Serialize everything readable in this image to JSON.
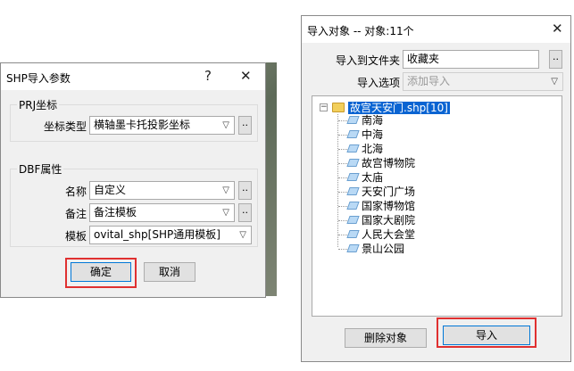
{
  "shp_dialog": {
    "title": "SHP导入参数",
    "help_glyph": "?",
    "close_glyph": "✕",
    "prj_group": {
      "label": "PRJ坐标",
      "coord_type_label": "坐标类型",
      "coord_type_value": "横轴墨卡托投影坐标"
    },
    "dbf_group": {
      "label": "DBF属性",
      "name_label": "名称",
      "name_value": "自定义",
      "note_label": "备注",
      "note_value": "备注模板",
      "template_label": "模板",
      "template_value": "ovital_shp[SHP通用模板]"
    },
    "browse_label": "..",
    "ok_label": "确定",
    "cancel_label": "取消"
  },
  "import_dialog": {
    "title": "导入对象 -- 对象:11个",
    "close_glyph": "✕",
    "folder_label": "导入到文件夹",
    "folder_value": "收藏夹",
    "option_label": "导入选项",
    "option_value": "添加导入",
    "browse_label": "..",
    "tree": {
      "root_label": "故宫天安门.shp[10]",
      "items": [
        "南海",
        "中海",
        "北海",
        "故宫博物院",
        "太庙",
        "天安门广场",
        "国家博物馆",
        "国家大剧院",
        "人民大会堂",
        "景山公园"
      ]
    },
    "delete_label": "删除对象",
    "import_label": "导入"
  },
  "colors": {
    "highlight_box": "#e03030",
    "selection": "#0a64d2",
    "default_button_border": "#0078d7"
  },
  "icons": {
    "dropdown": "▽",
    "expander": "−"
  }
}
